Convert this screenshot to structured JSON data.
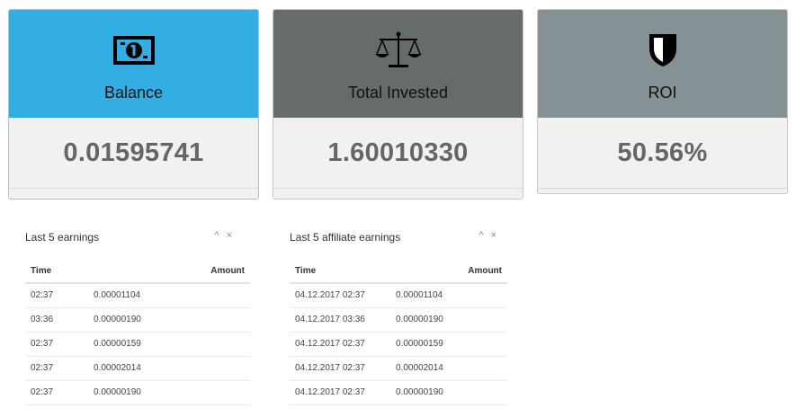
{
  "cards": [
    {
      "label": "Balance",
      "value": "0.01595741",
      "icon": "banknote-icon"
    },
    {
      "label": "Total Invested",
      "value": "1.60010330",
      "icon": "scales-icon"
    },
    {
      "label": "ROI",
      "value": "50.56%",
      "icon": "shield-icon"
    }
  ],
  "earnings": {
    "title": "Last 5 earnings",
    "collapse_icon": "^",
    "close_icon": "×",
    "columns": [
      "Time",
      "Amount"
    ],
    "rows": [
      {
        "time": "02:37",
        "amount": "0.00001104"
      },
      {
        "time": "03:36",
        "amount": "0.00000190"
      },
      {
        "time": "02:37",
        "amount": "0.00000159"
      },
      {
        "time": "02:37",
        "amount": "0.00002014"
      },
      {
        "time": "02:37",
        "amount": "0.00000190"
      }
    ]
  },
  "affiliate": {
    "title": "Last 5 affiliate earnings",
    "collapse_icon": "^",
    "close_icon": "×",
    "columns": [
      "Time",
      "Amount"
    ],
    "rows": [
      {
        "time": "04.12.2017 02:37",
        "amount": "0.00001104"
      },
      {
        "time": "04.12.2017 03:36",
        "amount": "0.00000190"
      },
      {
        "time": "04.12.2017 02:37",
        "amount": "0.00000159"
      },
      {
        "time": "04.12.2017 02:37",
        "amount": "0.00002014"
      },
      {
        "time": "04.12.2017 02:37",
        "amount": "0.00000190"
      }
    ]
  },
  "colors": {
    "balance": "#33aee2",
    "invested": "#666c6c",
    "roi": "#859195"
  }
}
